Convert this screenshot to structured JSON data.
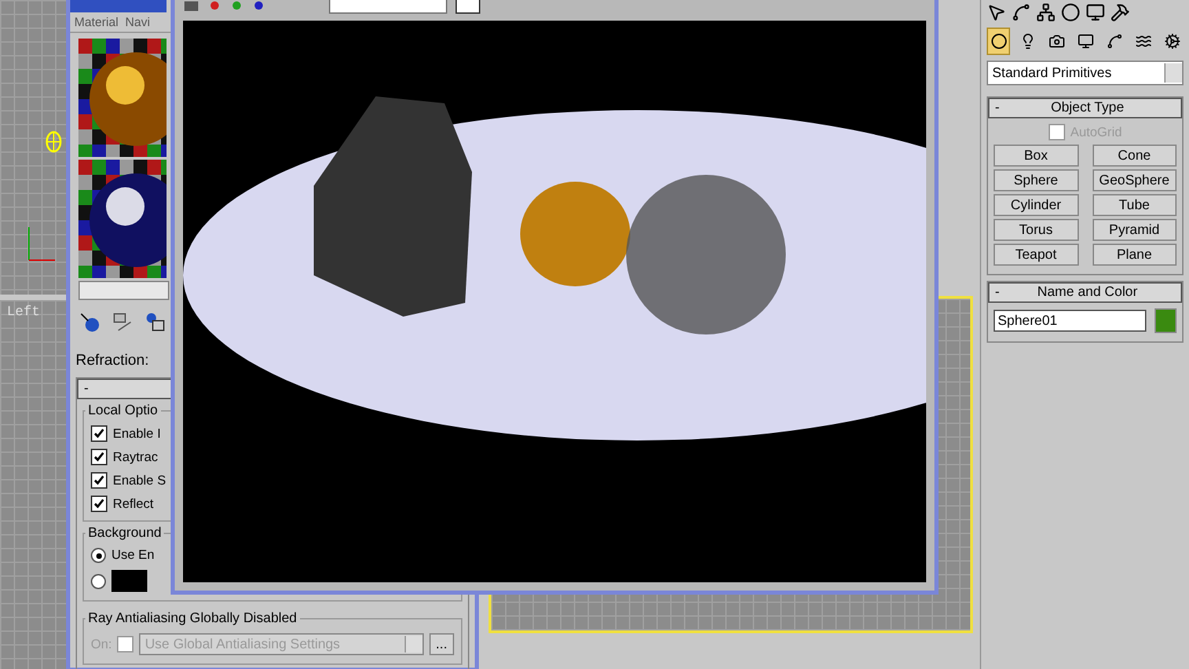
{
  "viewport": {
    "label": "Left"
  },
  "material_editor": {
    "menu": [
      "Material",
      "Navi"
    ],
    "refraction_label": "Refraction:",
    "rollout_toggle": "-",
    "local_options": {
      "title": "Local Optio",
      "options": [
        {
          "label": "Enable I",
          "checked": true
        },
        {
          "label": "Raytrac",
          "checked": true
        },
        {
          "label": "Enable S",
          "checked": true
        },
        {
          "label": "Reflect",
          "checked": true
        }
      ]
    },
    "background": {
      "title": "Background",
      "options": [
        {
          "kind": "text",
          "label": "Use En",
          "selected": true
        },
        {
          "kind": "swatch",
          "selected": false
        }
      ]
    },
    "antialiasing": {
      "title": "Ray Antialiasing Globally Disabled",
      "on_label": "On:",
      "on_checked": false,
      "disabled": true,
      "dropdown": "Use Global Antialiasing Settings",
      "more_button": "..."
    }
  },
  "command_panel": {
    "categories": [
      {
        "selected": true
      },
      {
        "selected": false
      },
      {
        "selected": false
      },
      {
        "selected": false
      },
      {
        "selected": false
      },
      {
        "selected": false
      },
      {
        "selected": false
      }
    ],
    "category_dropdown": "Standard Primitives",
    "object_type": {
      "toggle": "-",
      "title": "Object Type",
      "autogrid": {
        "label": "AutoGrid",
        "checked": false,
        "disabled": true
      },
      "buttons": [
        "Box",
        "Cone",
        "Sphere",
        "GeoSphere",
        "Cylinder",
        "Tube",
        "Torus",
        "Pyramid",
        "Teapot",
        "Plane"
      ]
    },
    "name_and_color": {
      "toggle": "-",
      "title": "Name and Color",
      "name": "Sphere01",
      "color": "#3a8a10"
    }
  }
}
